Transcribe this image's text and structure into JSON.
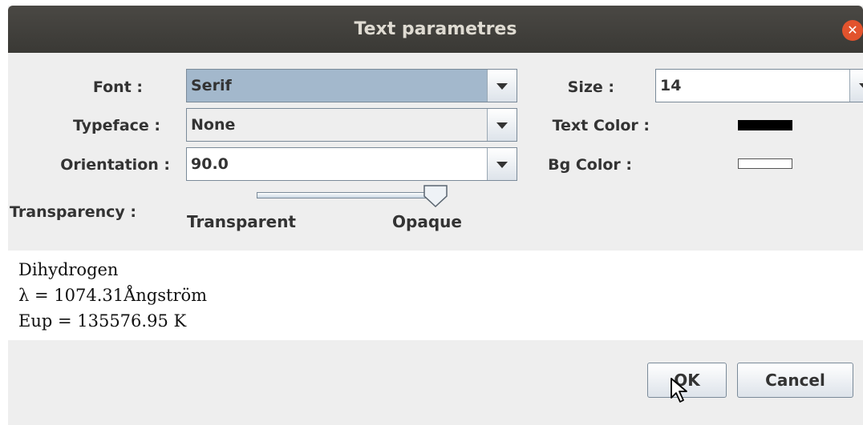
{
  "window": {
    "title": "Text parametres",
    "close_icon": "close-icon"
  },
  "font": {
    "label": "Font :",
    "value": "Serif"
  },
  "typeface": {
    "label": "Typeface :",
    "value": "None"
  },
  "orientation": {
    "label": "Orientation :",
    "value": "90.0"
  },
  "size": {
    "label": "Size :",
    "value": "14"
  },
  "text_color": {
    "label": "Text Color :",
    "color": "#000000"
  },
  "bg_color": {
    "label": "Bg Color :",
    "color": "#ffffff"
  },
  "transparency": {
    "label": "Transparency :",
    "min_label": "Transparent",
    "max_label": "Opaque",
    "value_fraction": 1.0
  },
  "preview": {
    "lines": [
      "Dihydrogen",
      "λ = 1074.31Ångström",
      "Eup = 135576.95 K"
    ]
  },
  "buttons": {
    "ok": "OK",
    "cancel": "Cancel"
  }
}
